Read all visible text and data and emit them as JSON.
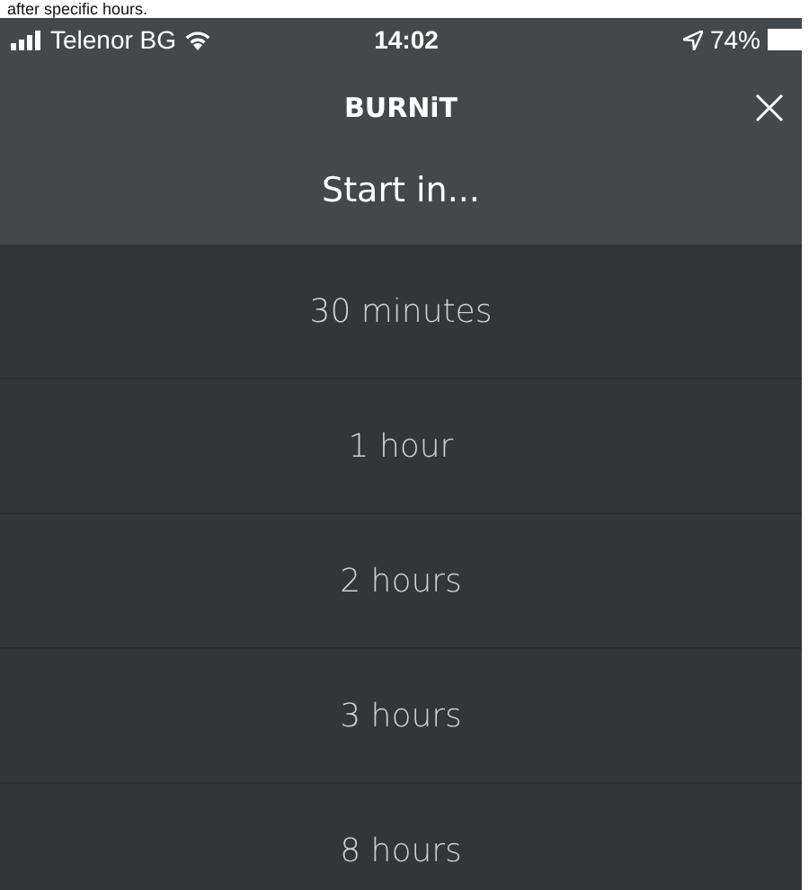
{
  "caption": "after specific hours.",
  "status_bar": {
    "carrier": "Telenor BG",
    "time": "14:02",
    "battery": "74%"
  },
  "nav": {
    "title": "BURNiT",
    "subtitle": "Start in..."
  },
  "options": [
    {
      "label": "30 minutes"
    },
    {
      "label": "1 hour"
    },
    {
      "label": "2 hours"
    },
    {
      "label": "3 hours"
    },
    {
      "label": "8 hours"
    }
  ]
}
